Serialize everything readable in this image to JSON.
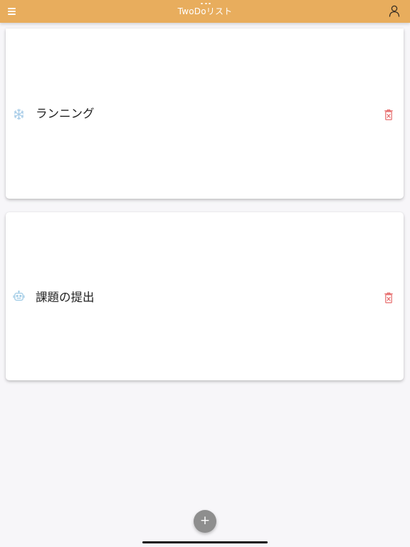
{
  "header": {
    "title": "TwoDoリスト",
    "menu_icon": "hamburger-menu-icon",
    "account_icon": "user-icon",
    "background_color": "#e8ad5d"
  },
  "tasks": [
    {
      "icon": "snowflake-icon",
      "icon_color": "#a9cde8",
      "label": "ランニング",
      "delete_icon": "trash-icon",
      "delete_color": "#e66a6a"
    },
    {
      "icon": "robot-icon",
      "icon_color": "#9ac8e4",
      "label": "課題の提出",
      "delete_icon": "trash-icon",
      "delete_color": "#e66a6a"
    }
  ],
  "fab": {
    "label": "+",
    "color": "#8e8e8e"
  }
}
